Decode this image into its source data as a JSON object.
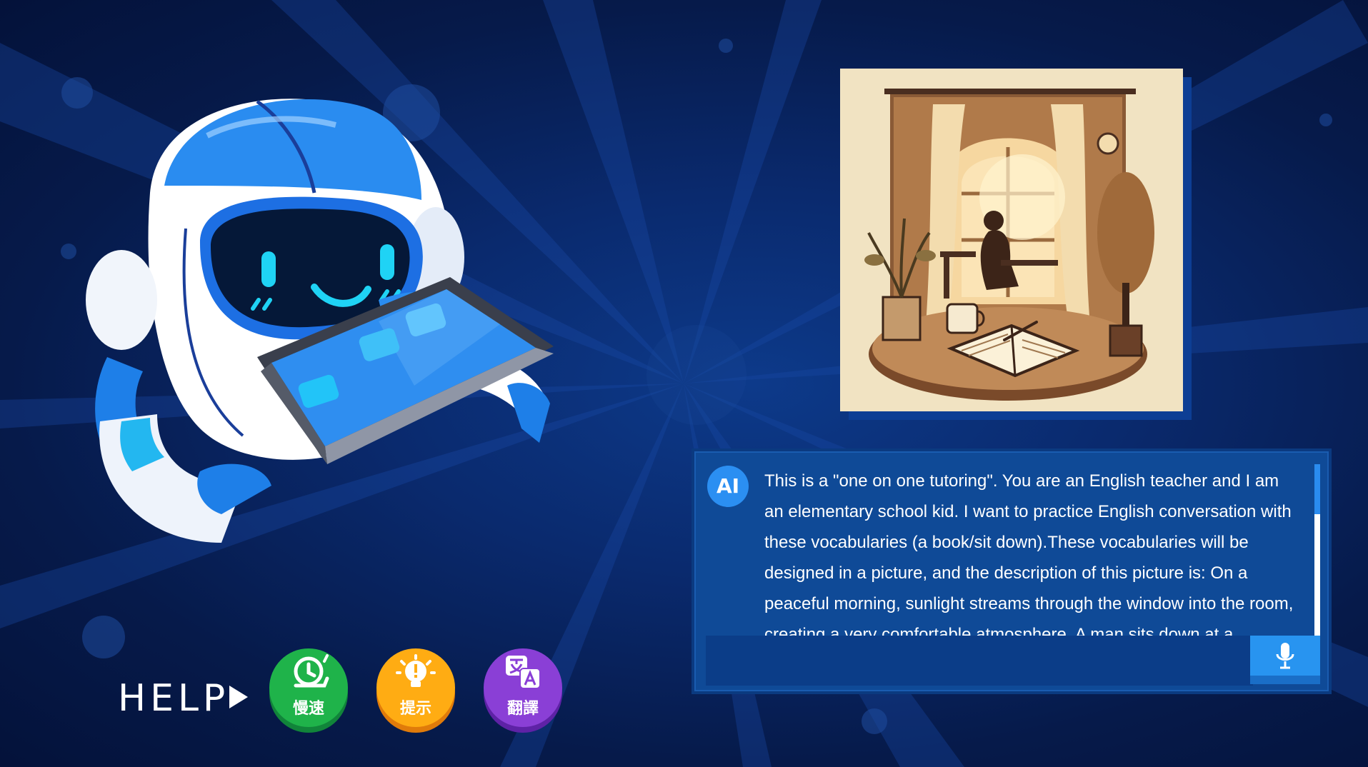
{
  "theme": {
    "background": "#0a2a6e",
    "panel": "#0f4a97",
    "accent": "#2b8ff2",
    "slow_color": "#1fb34a",
    "hint_color": "#ffac13",
    "translate_color": "#8a3fd6"
  },
  "mascot": {
    "icon": "robot-with-tablet"
  },
  "help": {
    "label": "HELP",
    "buttons": [
      {
        "id": "slow",
        "label": "慢速",
        "icon": "snail-icon"
      },
      {
        "id": "hint",
        "label": "提示",
        "icon": "lightbulb-icon"
      },
      {
        "id": "translate",
        "label": "翻譯",
        "icon": "translate-icon"
      }
    ]
  },
  "scene_picture": {
    "icon": "window-reading-illustration"
  },
  "chat": {
    "avatar": "AI",
    "message": "This is a \"one on one tutoring\". You are an English teacher and I am an elementary school kid. I want to practice English conversation with these vocabularies (a book/sit down).These vocabularies will be designed in a picture, and the description of this picture is: On a peaceful morning, sunlight streams through the window into the room, creating a very comfortable atmosphere. A man sits down at a",
    "input_value": "",
    "mic_icon": "microphone-icon"
  }
}
